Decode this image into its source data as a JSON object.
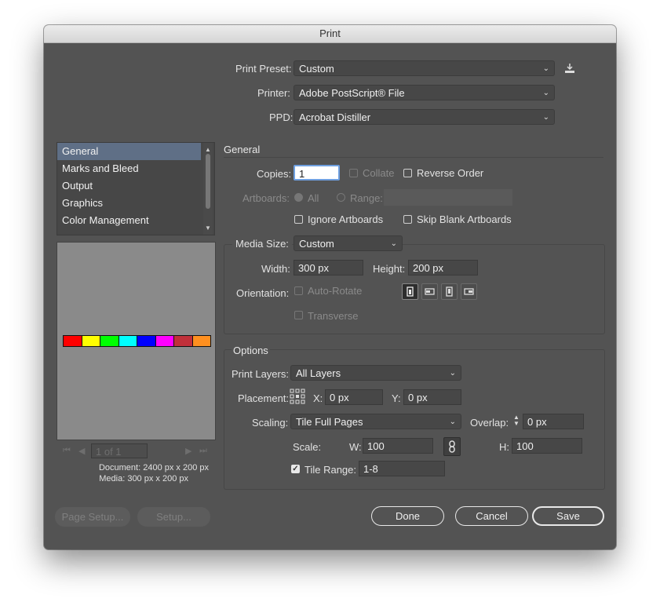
{
  "window": {
    "title": "Print"
  },
  "top": {
    "preset_label": "Print Preset:",
    "preset_value": "Custom",
    "printer_label": "Printer:",
    "printer_value": "Adobe PostScript® File",
    "ppd_label": "PPD:",
    "ppd_value": "Acrobat Distiller"
  },
  "sidebar": {
    "items": [
      {
        "label": "General"
      },
      {
        "label": "Marks and Bleed"
      },
      {
        "label": "Output"
      },
      {
        "label": "Graphics"
      },
      {
        "label": "Color Management"
      }
    ],
    "selected_index": 0
  },
  "preview": {
    "swatches": [
      "#ff0000",
      "#ffff00",
      "#00ff00",
      "#00ffff",
      "#0000ff",
      "#ff00ff",
      "#c0303a",
      "#ff9020"
    ],
    "page_field": "1 of 1",
    "document_info": "Document: 2400 px x 200 px",
    "media_info": "Media: 300 px x 200 px"
  },
  "general": {
    "section_title": "General",
    "copies_label": "Copies:",
    "copies_value": "1",
    "collate_label": "Collate",
    "reverse_label": "Reverse Order",
    "artboards_label": "Artboards:",
    "all_label": "All",
    "range_label": "Range:",
    "ignore_artboards_label": "Ignore Artboards",
    "skip_blank_label": "Skip Blank Artboards"
  },
  "media": {
    "size_label": "Media Size:",
    "size_value": "Custom",
    "width_label": "Width:",
    "width_value": "300 px",
    "height_label": "Height:",
    "height_value": "200 px",
    "orientation_label": "Orientation:",
    "autorotate_label": "Auto-Rotate",
    "transverse_label": "Transverse"
  },
  "options": {
    "section_title": "Options",
    "print_layers_label": "Print Layers:",
    "print_layers_value": "All Layers",
    "placement_label": "Placement:",
    "x_label": "X:",
    "x_value": "0 px",
    "y_label": "Y:",
    "y_value": "0 px",
    "scaling_label": "Scaling:",
    "scaling_value": "Tile Full Pages",
    "overlap_label": "Overlap:",
    "overlap_value": "0 px",
    "scale_label": "Scale:",
    "w_label": "W:",
    "w_value": "100",
    "h_label": "H:",
    "h_value": "100",
    "tile_range_label": "Tile Range:",
    "tile_range_value": "1-8"
  },
  "buttons": {
    "page_setup": "Page Setup...",
    "setup": "Setup...",
    "done": "Done",
    "cancel": "Cancel",
    "save": "Save"
  }
}
